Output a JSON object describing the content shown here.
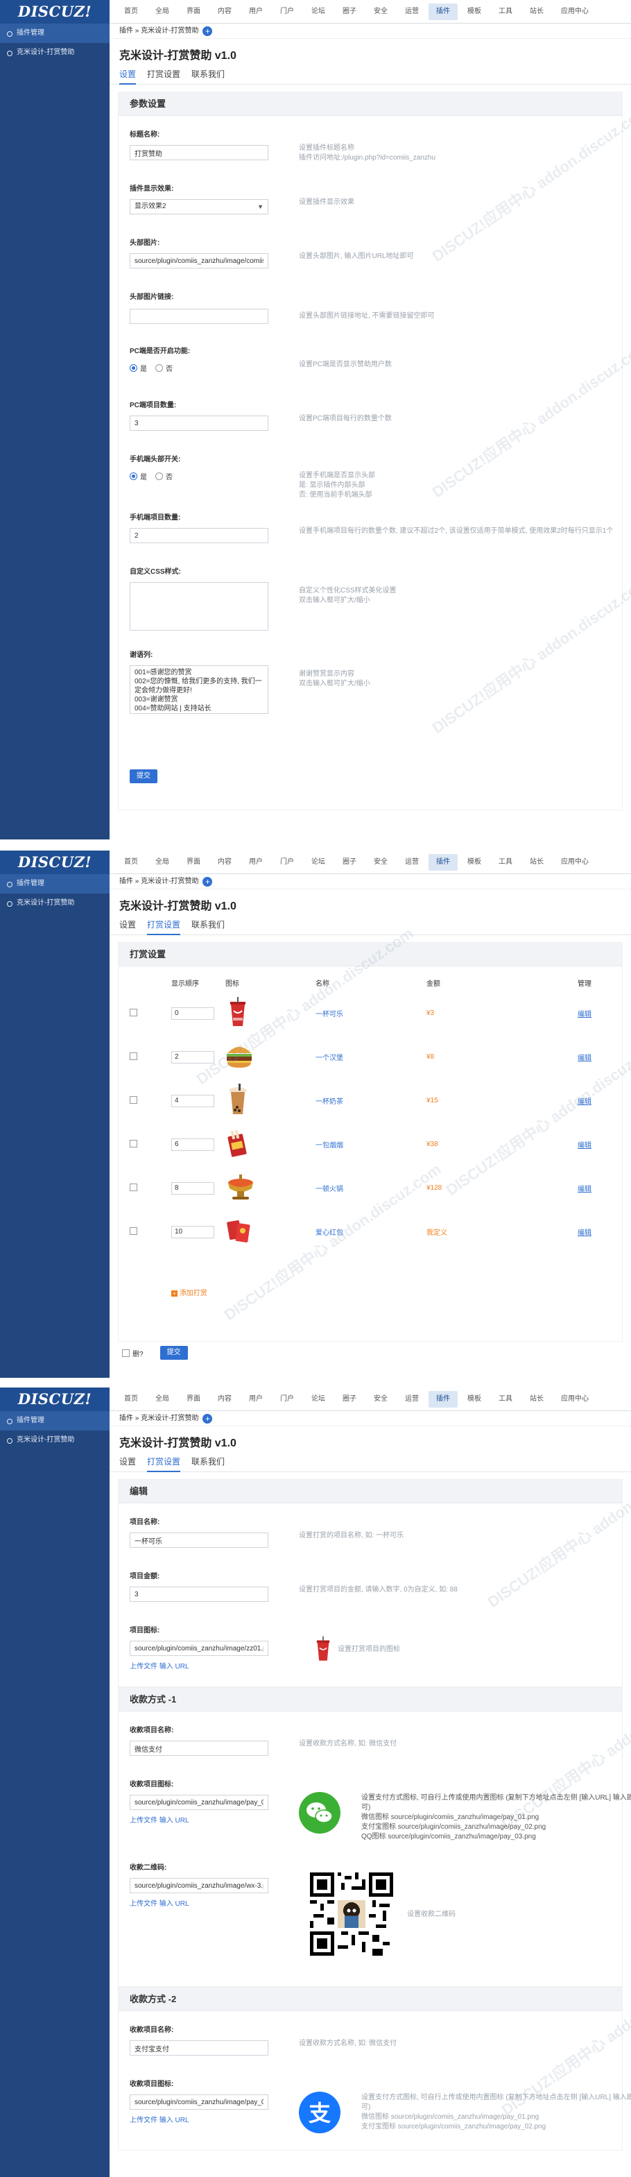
{
  "app": {
    "logo": "DISCUZ!",
    "nav": [
      "首页",
      "全局",
      "界面",
      "内容",
      "用户",
      "门户",
      "论坛",
      "圈子",
      "安全",
      "运营",
      "插件",
      "模板",
      "工具",
      "站长",
      "应用中心"
    ],
    "nav_active": "插件",
    "sidebar": [
      "插件管理",
      "克米设计-打赏赞助"
    ],
    "breadcrumb": "插件 » 克米设计-打赏赞助",
    "page_title": "克米设计-打赏赞助 v1.0",
    "tabs": [
      "设置",
      "打赏设置",
      "联系我们"
    ],
    "watermark": "DISCUZ!应用中心 addon.discuz.com"
  },
  "settings": {
    "section_title": "参数设置",
    "fields": {
      "title": {
        "label": "标题名称:",
        "value": "打赏赞助",
        "hint1": "设置插件标题名称",
        "hint2": "插件访问地址:/plugin.php?id=comiis_zanzhu"
      },
      "effect": {
        "label": "插件显示效果:",
        "value": "显示效果2",
        "hint": "设置插件显示效果"
      },
      "header_img": {
        "label": "头部图片:",
        "value": "source/plugin/comiis_zanzhu/image/comiis_",
        "hint": "设置头部图片, 输入图片URL地址即可"
      },
      "header_link": {
        "label": "头部图片链接:",
        "value": "",
        "hint": "设置头部图片链接地址, 不需要链接留空即可"
      },
      "pc_count": {
        "label": "PC端是否开启功能:",
        "yes": "是",
        "no": "否",
        "hint": "设置PC端是否显示赞助用户数"
      },
      "pc_num": {
        "label": "PC端项目数量:",
        "value": "3",
        "hint": "设置PC端项目每行的数量个数"
      },
      "mobile_head": {
        "label": "手机端头部开关:",
        "yes": "是",
        "no": "否",
        "hint1": "设置手机端是否显示头部",
        "hint2": "是: 显示插件内部头部",
        "hint3": "否: 使用当前手机端头部"
      },
      "mobile_num": {
        "label": "手机端项目数量:",
        "value": "2",
        "hint": "设置手机端项目每行的数量个数, 建议不超过2个, 该设置仅适用于简单模式, 使用效果2时每行只显示1个"
      },
      "css": {
        "label": "自定义CSS样式:",
        "value": "",
        "hint1": "自定义个性化CSS样式美化设置",
        "hint2": "双击输入框可扩大/缩小"
      },
      "words": {
        "label": "谢语列:",
        "value": "001=感谢您的赞赏\n002=您的慷慨, 给我们更多的支持, 我们一定会倾力做得更好!\n003=谢谢赞赏\n004=赞助网站 | 支持站长",
        "hint1": "谢谢赞赏显示内容",
        "hint2": "双击输入框可扩大/缩小"
      }
    },
    "submit": "提交"
  },
  "reward": {
    "section_title": "打赏设置",
    "headers": {
      "order": "显示顺序",
      "icon": "图标",
      "name": "名称",
      "amount": "金额",
      "manage": "管理"
    },
    "rows": [
      {
        "order": "0",
        "icon": "cola-icon",
        "name": "一杯可乐",
        "amount": "¥3",
        "manage": "编辑"
      },
      {
        "order": "2",
        "icon": "burger-icon",
        "name": "一个汉堡",
        "amount": "¥8",
        "manage": "编辑"
      },
      {
        "order": "4",
        "icon": "milktea-icon",
        "name": "一杯奶茶",
        "amount": "¥15",
        "manage": "编辑"
      },
      {
        "order": "6",
        "icon": "cigarette-icon",
        "name": "一包烟烟",
        "amount": "¥38",
        "manage": "编辑"
      },
      {
        "order": "8",
        "icon": "hotpot-icon",
        "name": "一顿火锅",
        "amount": "¥128",
        "manage": "编辑"
      },
      {
        "order": "10",
        "icon": "redpacket-icon",
        "name": "爱心红包",
        "amount": "我定义",
        "manage": "编辑"
      }
    ],
    "add": "添加打赏",
    "delete": "删?",
    "submit": "提交"
  },
  "edit": {
    "section_title": "编辑",
    "name": {
      "label": "项目名称:",
      "value": "一杯可乐",
      "hint": "设置打赏的项目名称, 如: 一杯可乐"
    },
    "amount": {
      "label": "项目金额:",
      "value": "3",
      "hint": "设置打赏项目的金额, 请输入数字, 0为自定义, 如: 88"
    },
    "icon": {
      "label": "项目图标:",
      "value": "source/plugin/comiis_zanzhu/image/zz01.p",
      "upload": "上传文件",
      "url": "输入 URL",
      "hint": "设置打赏项目的图标"
    },
    "pay1": {
      "title": "收款方式 -1",
      "name_label": "收款项目名称:",
      "name_value": "微信支付",
      "name_hint": "设置收款方式名称, 如: 微信支付",
      "icon_label": "收款项目图标:",
      "icon_value": "source/plugin/comiis_zanzhu/image/pay_01",
      "icon_hint1": "设置支付方式图标, 可自行上传或使用内置图标 (复制下方地址点击左侧 [输入URL] 输入即可)",
      "icon_hint2": "微信图标 source/plugin/comiis_zanzhu/image/pay_01.png",
      "icon_hint3": "支付宝图标 source/plugin/comiis_zanzhu/image/pay_02.png",
      "icon_hint4": "QQ图标 source/plugin/comiis_zanzhu/image/pay_03.png",
      "qr_label": "收款二维码:",
      "qr_value": "source/plugin/comiis_zanzhu/image/wx-3.p",
      "qr_hint": "设置收款二维码",
      "upload": "上传文件",
      "url": "输入 URL"
    },
    "pay2": {
      "title": "收款方式 -2",
      "name_label": "收款项目名称:",
      "name_value": "支付宝支付",
      "name_hint": "设置收款方式名称, 如: 微信支付",
      "icon_label": "收款项目图标:",
      "icon_value": "source/plugin/comiis_zanzhu/image/pay_02",
      "icon_hint1": "设置支付方式图标, 可自行上传或使用内置图标 (复制下方地址点击左侧 [输入URL] 输入即可)",
      "icon_hint2": "微信图标 source/plugin/comiis_zanzhu/image/pay_01.png",
      "icon_hint3": "支付宝图标 source/plugin/comiis_zanzhu/image/pay_02.png",
      "upload": "上传文件",
      "url": "输入 URL"
    }
  }
}
